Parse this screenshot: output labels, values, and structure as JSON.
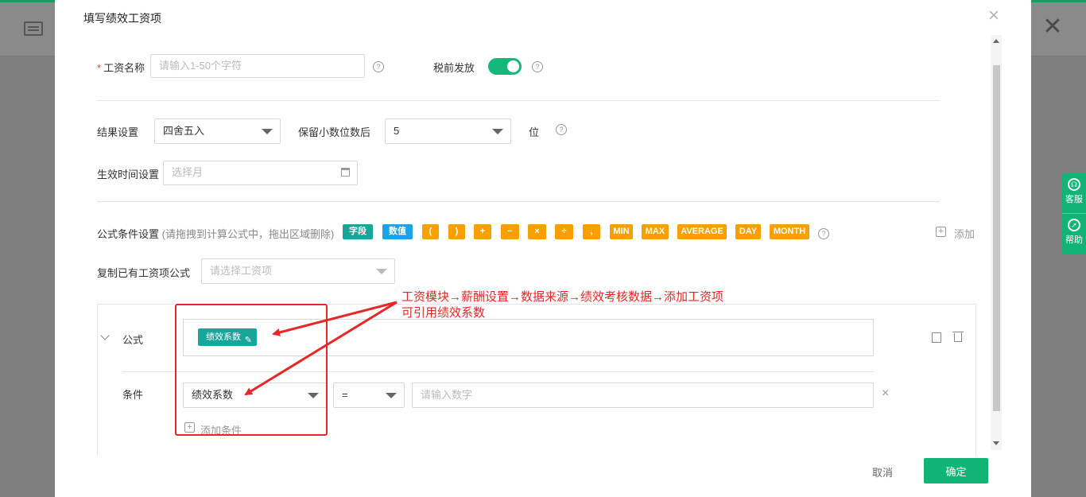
{
  "modal": {
    "title": "填写绩效工资项",
    "close_icon": "×"
  },
  "salary_name": {
    "label": "工资名称",
    "required": "*",
    "placeholder": "请输入1-50个字符"
  },
  "pretax": {
    "label": "税前发放",
    "enabled": true
  },
  "rounding": {
    "label": "结果设置",
    "value": "四舍五入"
  },
  "decimals": {
    "label": "保留小数位数后",
    "value": "5",
    "unit": "位"
  },
  "effective": {
    "label": "生效时间设置",
    "placeholder": "选择月"
  },
  "formula_condition": {
    "label": "公式条件设置",
    "hint": "(请拖拽到计算公式中，拖出区域删除)",
    "tags": [
      "字段",
      "数值",
      "(",
      ")",
      "+",
      "−",
      "×",
      "÷",
      ",",
      "MIN",
      "MAX",
      "AVERAGE",
      "DAY",
      "MONTH"
    ],
    "add_label": "添加"
  },
  "copy_formula": {
    "label": "复制已有工资项公式",
    "placeholder": "请选择工资项"
  },
  "formula": {
    "label": "公式",
    "chip": "绩效系数"
  },
  "condition": {
    "label": "条件",
    "field": "绩效系数",
    "operator": "=",
    "value_placeholder": "请输入数字",
    "add_condition": "添加条件"
  },
  "annotation": {
    "line1": "工资模块→薪酬设置→数据来源→绩效考核数据→添加工资项",
    "line2": "可引用绩效系数"
  },
  "buttons": {
    "cancel": "取消",
    "ok": "确定"
  },
  "side_help": {
    "service": "客服",
    "help": "帮助"
  },
  "colors": {
    "accent": "#10b576",
    "annotation": "#e62828",
    "teal": "#16a69a",
    "blue": "#1ca3e5",
    "orange": "#f7a000"
  }
}
